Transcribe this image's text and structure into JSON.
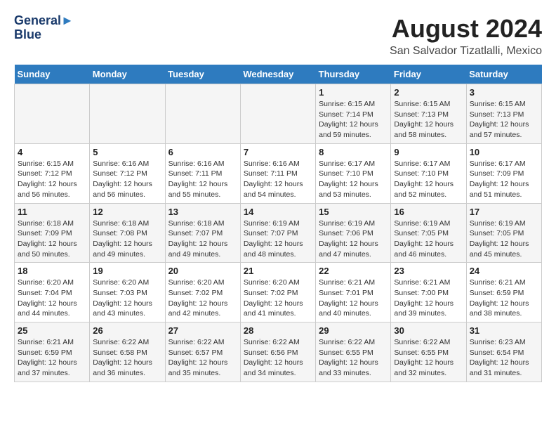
{
  "logo": {
    "line1": "General",
    "line2": "Blue"
  },
  "title": "August 2024",
  "location": "San Salvador Tizatlalli, Mexico",
  "weekdays": [
    "Sunday",
    "Monday",
    "Tuesday",
    "Wednesday",
    "Thursday",
    "Friday",
    "Saturday"
  ],
  "weeks": [
    [
      {
        "day": "",
        "sunrise": "",
        "sunset": "",
        "daylight": ""
      },
      {
        "day": "",
        "sunrise": "",
        "sunset": "",
        "daylight": ""
      },
      {
        "day": "",
        "sunrise": "",
        "sunset": "",
        "daylight": ""
      },
      {
        "day": "",
        "sunrise": "",
        "sunset": "",
        "daylight": ""
      },
      {
        "day": "1",
        "sunrise": "Sunrise: 6:15 AM",
        "sunset": "Sunset: 7:14 PM",
        "daylight": "Daylight: 12 hours and 59 minutes."
      },
      {
        "day": "2",
        "sunrise": "Sunrise: 6:15 AM",
        "sunset": "Sunset: 7:13 PM",
        "daylight": "Daylight: 12 hours and 58 minutes."
      },
      {
        "day": "3",
        "sunrise": "Sunrise: 6:15 AM",
        "sunset": "Sunset: 7:13 PM",
        "daylight": "Daylight: 12 hours and 57 minutes."
      }
    ],
    [
      {
        "day": "4",
        "sunrise": "Sunrise: 6:15 AM",
        "sunset": "Sunset: 7:12 PM",
        "daylight": "Daylight: 12 hours and 56 minutes."
      },
      {
        "day": "5",
        "sunrise": "Sunrise: 6:16 AM",
        "sunset": "Sunset: 7:12 PM",
        "daylight": "Daylight: 12 hours and 56 minutes."
      },
      {
        "day": "6",
        "sunrise": "Sunrise: 6:16 AM",
        "sunset": "Sunset: 7:11 PM",
        "daylight": "Daylight: 12 hours and 55 minutes."
      },
      {
        "day": "7",
        "sunrise": "Sunrise: 6:16 AM",
        "sunset": "Sunset: 7:11 PM",
        "daylight": "Daylight: 12 hours and 54 minutes."
      },
      {
        "day": "8",
        "sunrise": "Sunrise: 6:17 AM",
        "sunset": "Sunset: 7:10 PM",
        "daylight": "Daylight: 12 hours and 53 minutes."
      },
      {
        "day": "9",
        "sunrise": "Sunrise: 6:17 AM",
        "sunset": "Sunset: 7:10 PM",
        "daylight": "Daylight: 12 hours and 52 minutes."
      },
      {
        "day": "10",
        "sunrise": "Sunrise: 6:17 AM",
        "sunset": "Sunset: 7:09 PM",
        "daylight": "Daylight: 12 hours and 51 minutes."
      }
    ],
    [
      {
        "day": "11",
        "sunrise": "Sunrise: 6:18 AM",
        "sunset": "Sunset: 7:09 PM",
        "daylight": "Daylight: 12 hours and 50 minutes."
      },
      {
        "day": "12",
        "sunrise": "Sunrise: 6:18 AM",
        "sunset": "Sunset: 7:08 PM",
        "daylight": "Daylight: 12 hours and 49 minutes."
      },
      {
        "day": "13",
        "sunrise": "Sunrise: 6:18 AM",
        "sunset": "Sunset: 7:07 PM",
        "daylight": "Daylight: 12 hours and 49 minutes."
      },
      {
        "day": "14",
        "sunrise": "Sunrise: 6:19 AM",
        "sunset": "Sunset: 7:07 PM",
        "daylight": "Daylight: 12 hours and 48 minutes."
      },
      {
        "day": "15",
        "sunrise": "Sunrise: 6:19 AM",
        "sunset": "Sunset: 7:06 PM",
        "daylight": "Daylight: 12 hours and 47 minutes."
      },
      {
        "day": "16",
        "sunrise": "Sunrise: 6:19 AM",
        "sunset": "Sunset: 7:05 PM",
        "daylight": "Daylight: 12 hours and 46 minutes."
      },
      {
        "day": "17",
        "sunrise": "Sunrise: 6:19 AM",
        "sunset": "Sunset: 7:05 PM",
        "daylight": "Daylight: 12 hours and 45 minutes."
      }
    ],
    [
      {
        "day": "18",
        "sunrise": "Sunrise: 6:20 AM",
        "sunset": "Sunset: 7:04 PM",
        "daylight": "Daylight: 12 hours and 44 minutes."
      },
      {
        "day": "19",
        "sunrise": "Sunrise: 6:20 AM",
        "sunset": "Sunset: 7:03 PM",
        "daylight": "Daylight: 12 hours and 43 minutes."
      },
      {
        "day": "20",
        "sunrise": "Sunrise: 6:20 AM",
        "sunset": "Sunset: 7:02 PM",
        "daylight": "Daylight: 12 hours and 42 minutes."
      },
      {
        "day": "21",
        "sunrise": "Sunrise: 6:20 AM",
        "sunset": "Sunset: 7:02 PM",
        "daylight": "Daylight: 12 hours and 41 minutes."
      },
      {
        "day": "22",
        "sunrise": "Sunrise: 6:21 AM",
        "sunset": "Sunset: 7:01 PM",
        "daylight": "Daylight: 12 hours and 40 minutes."
      },
      {
        "day": "23",
        "sunrise": "Sunrise: 6:21 AM",
        "sunset": "Sunset: 7:00 PM",
        "daylight": "Daylight: 12 hours and 39 minutes."
      },
      {
        "day": "24",
        "sunrise": "Sunrise: 6:21 AM",
        "sunset": "Sunset: 6:59 PM",
        "daylight": "Daylight: 12 hours and 38 minutes."
      }
    ],
    [
      {
        "day": "25",
        "sunrise": "Sunrise: 6:21 AM",
        "sunset": "Sunset: 6:59 PM",
        "daylight": "Daylight: 12 hours and 37 minutes."
      },
      {
        "day": "26",
        "sunrise": "Sunrise: 6:22 AM",
        "sunset": "Sunset: 6:58 PM",
        "daylight": "Daylight: 12 hours and 36 minutes."
      },
      {
        "day": "27",
        "sunrise": "Sunrise: 6:22 AM",
        "sunset": "Sunset: 6:57 PM",
        "daylight": "Daylight: 12 hours and 35 minutes."
      },
      {
        "day": "28",
        "sunrise": "Sunrise: 6:22 AM",
        "sunset": "Sunset: 6:56 PM",
        "daylight": "Daylight: 12 hours and 34 minutes."
      },
      {
        "day": "29",
        "sunrise": "Sunrise: 6:22 AM",
        "sunset": "Sunset: 6:55 PM",
        "daylight": "Daylight: 12 hours and 33 minutes."
      },
      {
        "day": "30",
        "sunrise": "Sunrise: 6:22 AM",
        "sunset": "Sunset: 6:55 PM",
        "daylight": "Daylight: 12 hours and 32 minutes."
      },
      {
        "day": "31",
        "sunrise": "Sunrise: 6:23 AM",
        "sunset": "Sunset: 6:54 PM",
        "daylight": "Daylight: 12 hours and 31 minutes."
      }
    ]
  ]
}
